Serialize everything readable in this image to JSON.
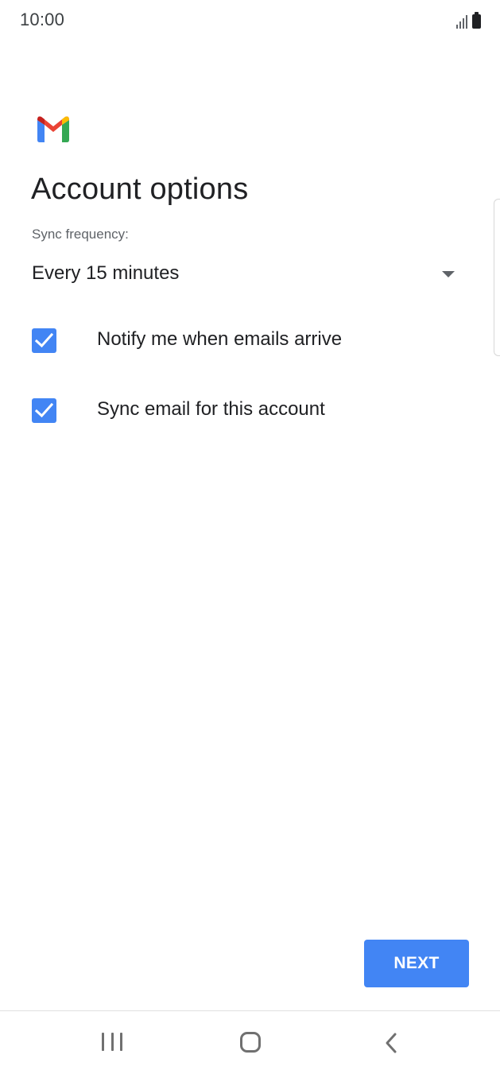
{
  "status_bar": {
    "time": "10:00",
    "icons": [
      "signal-icon",
      "battery-icon"
    ]
  },
  "app": {
    "logo": "gmail-logo",
    "colors": {
      "red": "#ea4335",
      "blue": "#4285f4",
      "green": "#34a853",
      "yellow": "#fbbc04"
    }
  },
  "page": {
    "title": "Account options"
  },
  "sync": {
    "label": "Sync frequency:",
    "selected_value": "Every 15 minutes",
    "icon": "dropdown-arrow-icon"
  },
  "options": [
    {
      "label": "Notify me when emails arrive",
      "checked": true
    },
    {
      "label": "Sync email for this account",
      "checked": true
    }
  ],
  "actions": {
    "next_label": "NEXT",
    "accent_color": "#4285f4"
  },
  "nav_bar": {
    "icons": [
      "recents-icon",
      "home-icon",
      "back-icon"
    ]
  }
}
